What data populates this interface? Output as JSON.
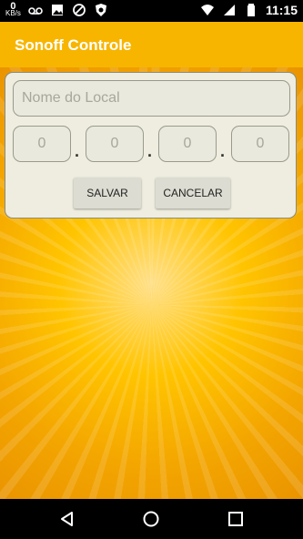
{
  "status_bar": {
    "speed_value": "0",
    "speed_unit": "KB/s",
    "time": "11:15",
    "icons": [
      "voicemail-icon",
      "image-icon",
      "blocked-icon",
      "shield-icon",
      "wifi-icon",
      "signal-icon",
      "battery-icon"
    ]
  },
  "app_bar": {
    "title": "Sonoff Controle"
  },
  "form": {
    "name_placeholder": "Nome do Local",
    "ip_octets": [
      "0",
      "0",
      "0",
      "0"
    ],
    "separator": ".",
    "save_label": "SALVAR",
    "cancel_label": "CANCELAR"
  },
  "nav_bar": {
    "buttons": [
      "back-icon",
      "home-icon",
      "recents-icon"
    ]
  },
  "colors": {
    "app_bar": "#f7b500",
    "background": "#ffc400",
    "card": "#eeeddf"
  }
}
